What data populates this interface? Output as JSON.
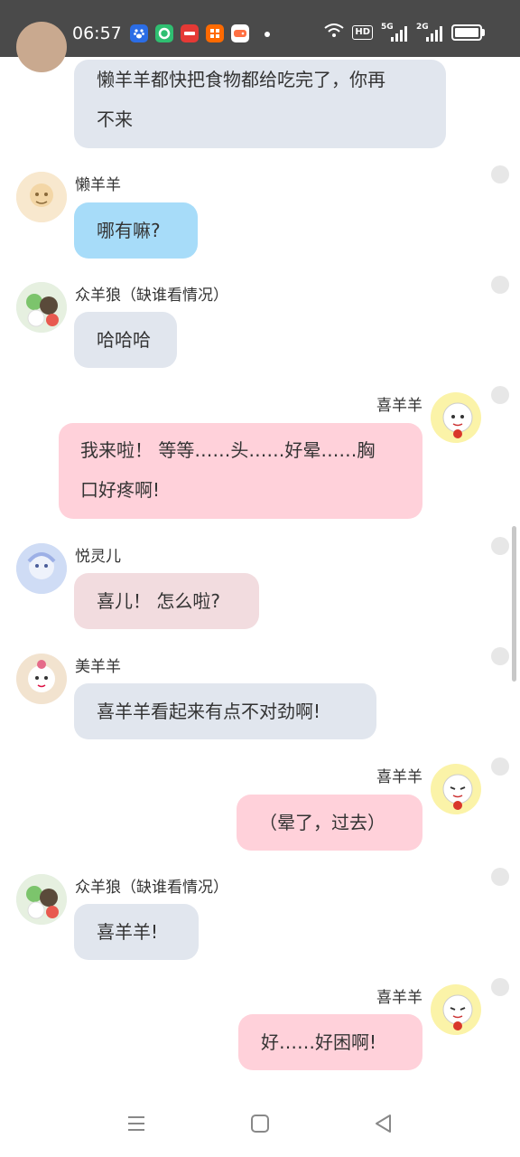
{
  "status_bar": {
    "time": "06:57",
    "apps": [
      {
        "icon": "baidu-paw-icon",
        "label": "",
        "color": "#2b6de6"
      },
      {
        "icon": "green-circle-app-icon",
        "label": "",
        "color": "#2fbf71"
      },
      {
        "icon": "news-app-icon",
        "label": "",
        "color": "#e53935"
      },
      {
        "icon": "taobao-app-icon",
        "label": "",
        "color": "#ff6a00"
      },
      {
        "icon": "game-app-icon",
        "label": "",
        "color": "#ff7043"
      }
    ],
    "hd_badge": "HD",
    "net1": "5G",
    "net2": "2G"
  },
  "messages": [
    {
      "side": "left",
      "speaker": "",
      "text_lines": [
        "懒羊羊都快把食物都给吃完了，你再",
        "不来"
      ],
      "color": "#e1e6ee"
    },
    {
      "side": "left",
      "speaker": "懒羊羊",
      "text_lines": [
        "哪有嘛?"
      ],
      "color": "#a7dcf9"
    },
    {
      "side": "left",
      "speaker": "众羊狼（缺谁看情况）",
      "text_lines": [
        "哈哈哈"
      ],
      "color": "#e1e6ee"
    },
    {
      "side": "right",
      "speaker": "喜羊羊",
      "text_lines": [
        "我来啦！ 等等……头……好晕……胸",
        "口好疼啊!"
      ],
      "color": "#ffd1da"
    },
    {
      "side": "left",
      "speaker": "悦灵儿",
      "text_lines": [
        "喜儿！ 怎么啦?"
      ],
      "color": "#f2dcdf"
    },
    {
      "side": "left",
      "speaker": "美羊羊",
      "text_lines": [
        "喜羊羊看起来有点不对劲啊!"
      ],
      "color": "#e1e6ee"
    },
    {
      "side": "right",
      "speaker": "喜羊羊",
      "text_lines": [
        "（晕了，过去）"
      ],
      "color": "#ffd1da"
    },
    {
      "side": "left",
      "speaker": "众羊狼（缺谁看情况）",
      "text_lines": [
        "喜羊羊!"
      ],
      "color": "#e1e6ee"
    },
    {
      "side": "right",
      "speaker": "喜羊羊",
      "text_lines": [
        "好……好困啊!"
      ],
      "color": "#ffd1da"
    }
  ],
  "nav": {
    "menu_icon": "menu-icon",
    "home_icon": "home-square-icon",
    "back_icon": "back-triangle-icon"
  }
}
